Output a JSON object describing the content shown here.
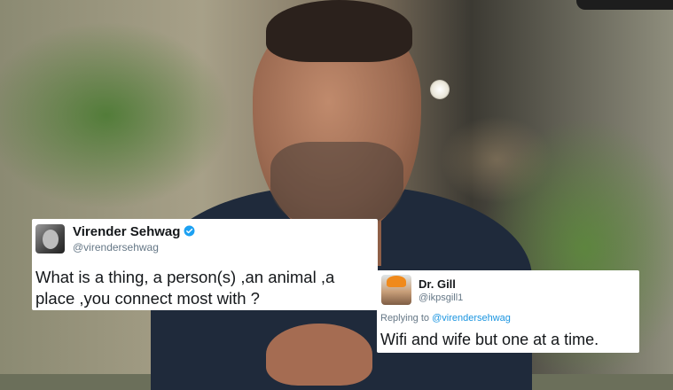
{
  "tweets": [
    {
      "name": "Virender Sehwag",
      "handle": "@virendersehwag",
      "verified": true,
      "text_line1": "What is a thing, a person(s) ,an animal ,a",
      "text_line2": "place ,you connect most with ?"
    },
    {
      "name": "Dr. Gill",
      "handle": "@ikpsgill1",
      "reply_prefix": "Replying to ",
      "reply_mention": "@virendersehwag",
      "text": "Wifi and wife but one at a time."
    }
  ],
  "colors": {
    "tweet_background": "#ffffff",
    "name_text": "#14171a",
    "secondary_text": "#657786",
    "mention_link": "#1b95e0",
    "verified_badge": "#1da1f2"
  },
  "icons": {
    "verified": "verified-badge-icon"
  }
}
